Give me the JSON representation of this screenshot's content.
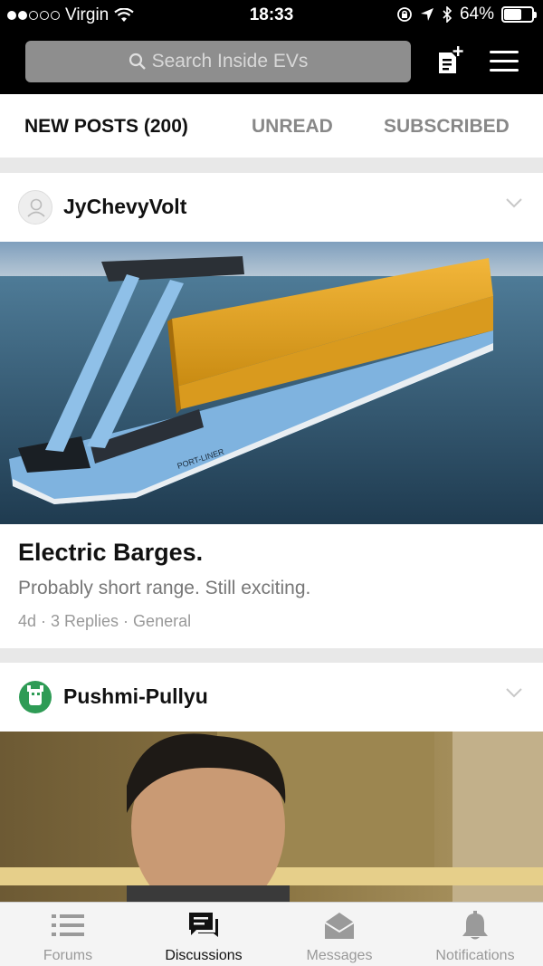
{
  "status": {
    "carrier": "Virgin",
    "time": "18:33",
    "battery": "64%",
    "battery_level": 0.64
  },
  "header": {
    "search_placeholder": "Search Inside EVs",
    "new_post_icon": "new-post-icon",
    "menu_icon": "menu-icon"
  },
  "tabs": [
    {
      "label": "NEW POSTS (200)",
      "active": true
    },
    {
      "label": "UNREAD",
      "active": false
    },
    {
      "label": "SUBSCRIBED",
      "active": false
    }
  ],
  "posts": [
    {
      "author": "JyChevyVolt",
      "image_text": "PORT-LINER",
      "title": "Electric Barges.",
      "body": "Probably short range. Still exciting.",
      "meta": "4d · 3 Replies · General"
    },
    {
      "author": "Pushmi-Pullyu"
    }
  ],
  "bottom_nav": [
    {
      "label": "Forums",
      "icon": "list-icon",
      "active": false
    },
    {
      "label": "Discussions",
      "icon": "chat-icon",
      "active": true
    },
    {
      "label": "Messages",
      "icon": "envelope-icon",
      "active": false
    },
    {
      "label": "Notifications",
      "icon": "bell-icon",
      "active": false
    }
  ],
  "colors": {
    "header_bg": "#000000",
    "barge_hull": "#7fb3df",
    "containers": "#e2a51c",
    "sea": "#3f6a86"
  }
}
